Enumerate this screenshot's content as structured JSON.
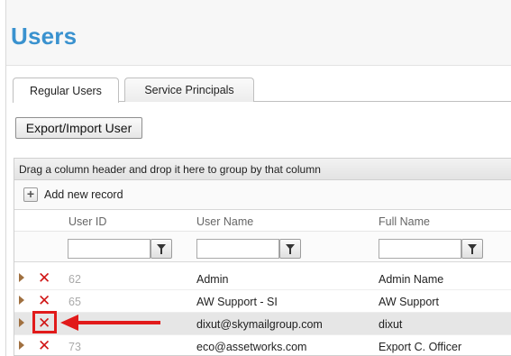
{
  "page": {
    "title": "Users"
  },
  "tabs": [
    {
      "label": "Regular Users",
      "active": true
    },
    {
      "label": "Service Principals",
      "active": false
    }
  ],
  "toolbar": {
    "export_label": "Export/Import User"
  },
  "grid": {
    "group_hint": "Drag a column header and drop it here to group by that column",
    "add_label": "Add new record",
    "columns": [
      "User ID",
      "User Name",
      "Full Name"
    ],
    "rows": [
      {
        "id": "62",
        "user_name": "Admin",
        "full_name": "Admin Name"
      },
      {
        "id": "65",
        "user_name": "AW Support - SI",
        "full_name": "AW Support"
      },
      {
        "id": "",
        "user_name": "dixut@skymailgroup.com",
        "full_name": "dixut"
      },
      {
        "id": "73",
        "user_name": "eco@assetworks.com",
        "full_name": "Export C. Officer"
      }
    ]
  },
  "icons": {
    "expand": "expand-arrow-icon",
    "delete": "delete-x-icon",
    "filter": "filter-funnel-icon",
    "add": "plus-icon"
  },
  "colors": {
    "title": "#3a92cf",
    "delete": "#d01515",
    "annotation": "#e11a1a"
  }
}
